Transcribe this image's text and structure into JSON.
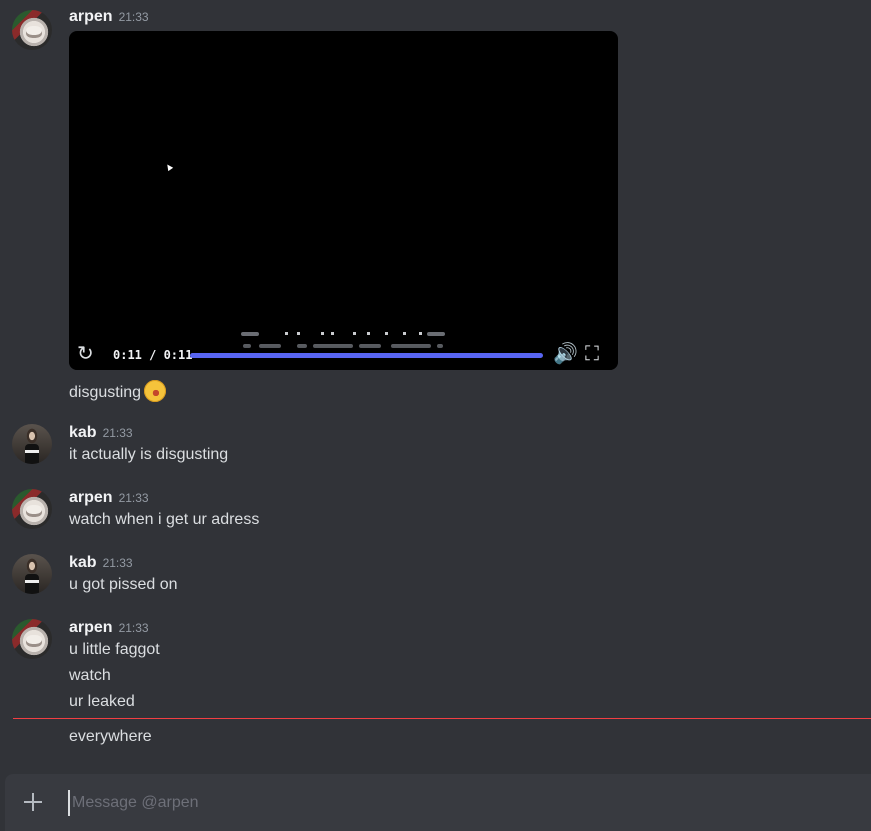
{
  "messages": {
    "g1": {
      "author": "arpen",
      "time": "21:33",
      "lines": [
        "disgusting"
      ]
    },
    "g2": {
      "author": "kab",
      "time": "21:33",
      "lines": [
        "it actually is disgusting"
      ]
    },
    "g3": {
      "author": "arpen",
      "time": "21:33",
      "lines": [
        "watch when i get ur adress"
      ]
    },
    "g4": {
      "author": "kab",
      "time": "21:33",
      "lines": [
        "u got pissed on"
      ]
    },
    "g5": {
      "author": "arpen",
      "time": "21:33",
      "lines": [
        "u little faggot",
        "watch",
        "ur leaked",
        "everywhere"
      ]
    }
  },
  "video": {
    "time_label": "0:11 / 0:11",
    "progress": 1.0
  },
  "icons": {
    "replay": "replay-icon",
    "volume": "volume-icon",
    "fullscreen": "fullscreen-icon",
    "add": "plus-icon",
    "emoji": "rolling-on-floor-laughing-emoji"
  },
  "composer": {
    "placeholder": "Message @arpen"
  },
  "colors": {
    "background": "#313338",
    "accent": "#5865f2",
    "new_messages_divider": "#f23f43",
    "composer": "#383a40"
  }
}
